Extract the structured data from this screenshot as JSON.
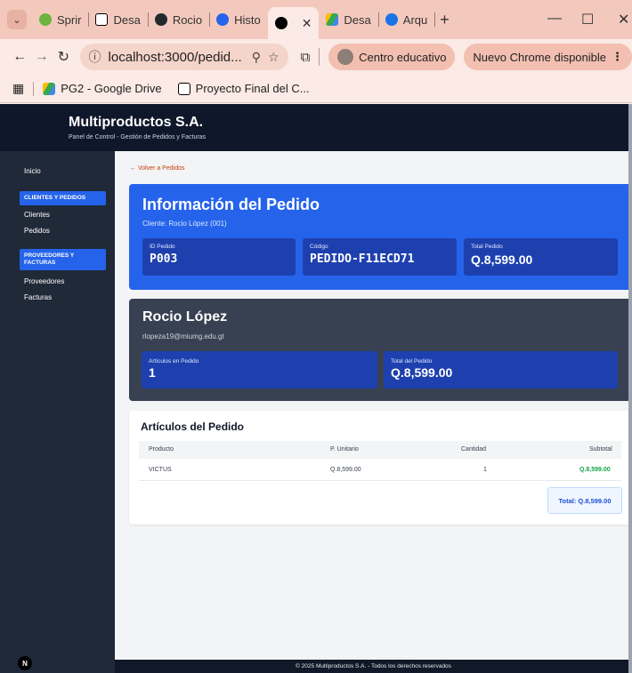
{
  "browser": {
    "tabs": [
      {
        "label": "Sprir",
        "color": "#6db33f"
      },
      {
        "label": "Desa",
        "color": "#000000"
      },
      {
        "label": "Rocio",
        "color": "#24292e"
      },
      {
        "label": "Histo",
        "color": "#2563eb"
      },
      {
        "label": "",
        "color": "#000000"
      },
      {
        "label": "Desa",
        "color": "#34a853"
      },
      {
        "label": "Arqu",
        "color": "#1a73e8"
      }
    ],
    "url": "localhost:3000/pedid...",
    "profile_label": "Centro educativo",
    "update_label": "Nuevo Chrome disponible",
    "bookmarks": [
      {
        "label": "PG2 - Google Drive"
      },
      {
        "label": "Proyecto Final del C..."
      }
    ]
  },
  "app": {
    "title": "Multiproductos S.A.",
    "subtitle": "Panel de Control - Gestión de Pedidos y Facturas",
    "badge": "N"
  },
  "sidebar": {
    "inicio": "Inicio",
    "group1": "CLIENTES Y PEDIDOS",
    "clientes": "Clientes",
    "pedidos": "Pedidos",
    "group2": "PROVEEDORES Y FACTURAS",
    "proveedores": "Proveedores",
    "facturas": "Facturas"
  },
  "order": {
    "back_link": "← Volver a Pedidos",
    "title": "Información del Pedido",
    "client_line": "Cliente: Rocio López (001)",
    "id_label": "ID Pedido",
    "id_value": "P003",
    "code_label": "Código",
    "code_value": "PEDIDO-F11ECD71",
    "total_label": "Total Pedido",
    "total_value": "Q.8,599.00"
  },
  "customer": {
    "name": "Rocio López",
    "email": "rlopeza19@miumg.edu.gt",
    "items_label": "Artículos en Pedido",
    "items_value": "1",
    "total_label": "Total del Pedido",
    "total_value": "Q.8,599.00"
  },
  "items": {
    "title": "Artículos del Pedido",
    "headers": {
      "producto": "Producto",
      "unitario": "P. Unitario",
      "cantidad": "Cantidad",
      "subtotal": "Subtotal"
    },
    "rows": [
      {
        "producto": "VICTUS",
        "unitario": "Q.8,599.00",
        "cantidad": "1",
        "subtotal": "Q.8,599.00"
      }
    ],
    "total": "Total: Q.8,599.00"
  },
  "footer": "© 2025 Multiproductos S.A. - Todos los derechos reservados"
}
